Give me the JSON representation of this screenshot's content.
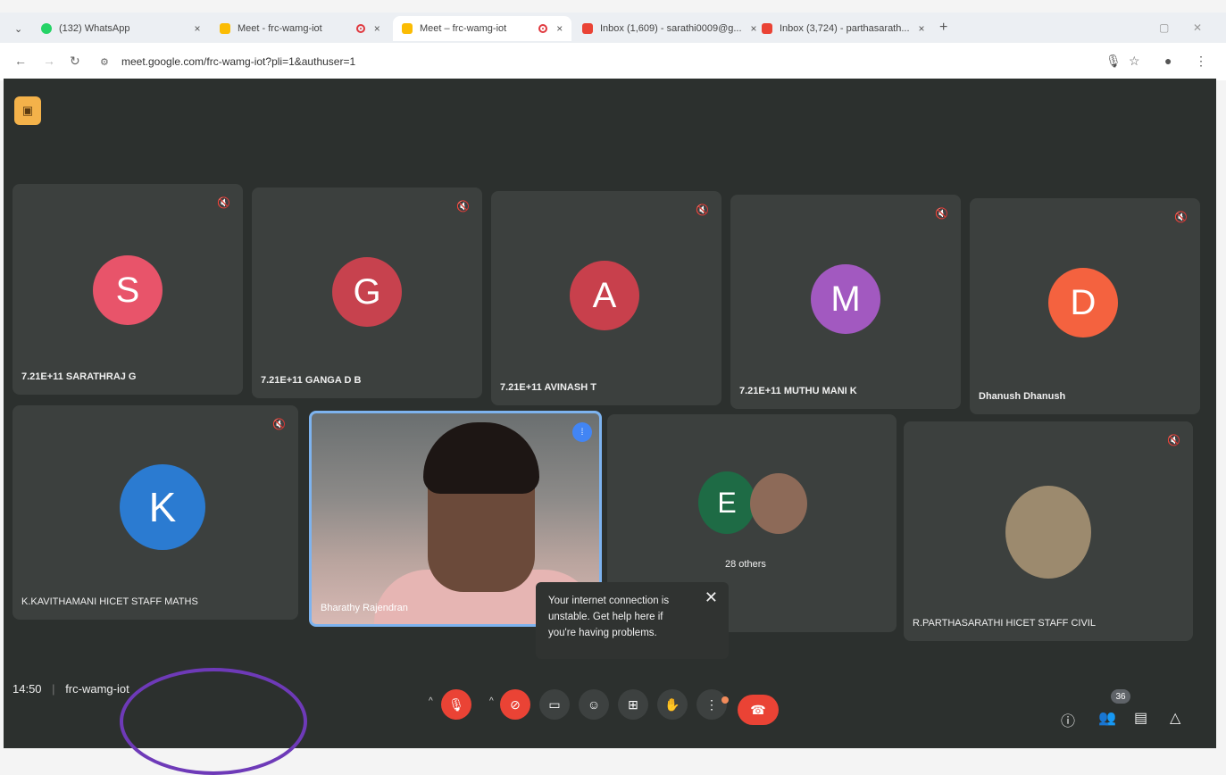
{
  "browser": {
    "tabs": [
      {
        "label": "(132) WhatsApp",
        "color": "#25d366"
      },
      {
        "label": "Meet - frc-wamg-iot",
        "color": "#fbbc04"
      },
      {
        "label": "Meet – frc-wamg-iot",
        "color": "#fbbc04"
      },
      {
        "label": "Inbox (1,609) - sarathi0009@g...",
        "color": "#ea4335"
      },
      {
        "label": "Inbox (3,724) - parthasarath...",
        "color": "#ea4335"
      }
    ],
    "url": "meet.google.com/frc-wamg-iot?pli=1&authuser=1"
  },
  "participants": [
    {
      "initial": "S",
      "name": "7.21E+11 SARATHRAJ G",
      "color": "#e8546a"
    },
    {
      "initial": "G",
      "name": "7.21E+11 GANGA D B",
      "color": "#c7424e"
    },
    {
      "initial": "A",
      "name": "7.21E+11 AVINASH T",
      "color": "#c8404c"
    },
    {
      "initial": "M",
      "name": "7.21E+11 MUTHU MANI K",
      "color": "#a259c0"
    },
    {
      "initial": "D",
      "name": "Dhanush Dhanush",
      "color": "#f4623f"
    },
    {
      "initial": "K",
      "name": "K.KAVITHAMANI HICET STAFF MATHS",
      "color": "#2b7bd1"
    }
  ],
  "speaker": {
    "name": "Bharathy Rajendran"
  },
  "others": {
    "initial": "E",
    "label": "28 others",
    "color": "#1e6b45"
  },
  "photo_participant": {
    "name": "R.PARTHASARATHI HICET STAFF CIVIL"
  },
  "toast": {
    "text": "Your internet connection is unstable. Get help here if you're having problems.",
    "close": "✕"
  },
  "meeting": {
    "time": "14:50",
    "separator": "|",
    "code": "frc-wamg-iot",
    "participant_count": "36"
  }
}
